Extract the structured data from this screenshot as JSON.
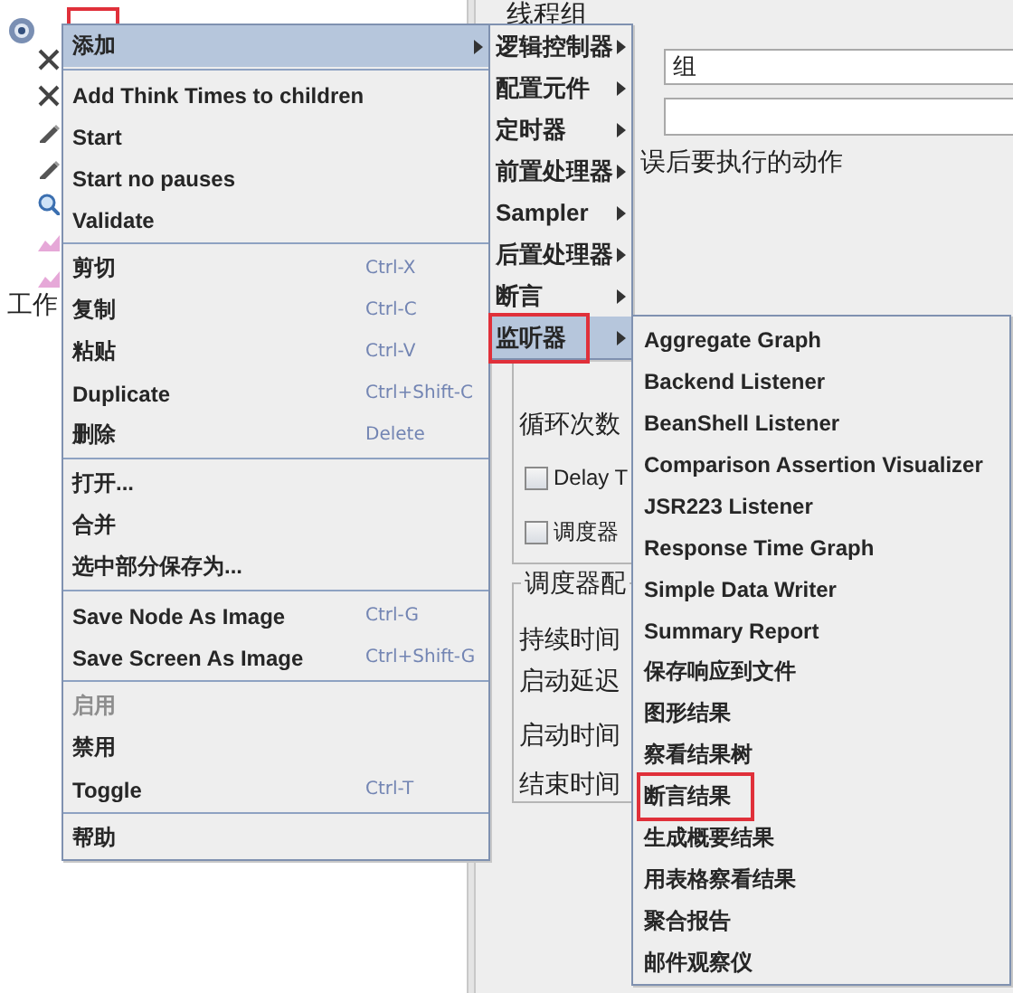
{
  "tree": {
    "root": {
      "annotated": true
    },
    "workbench": "工作"
  },
  "panel": {
    "title": "线程组",
    "name_value": "组",
    "error_action_label": "误后要执行的动作",
    "loop_label": "循环次数",
    "checkboxes": [
      {
        "label": "Delay T",
        "checked": false
      },
      {
        "label": "调度器",
        "checked": false
      }
    ],
    "scheduler_title": "调度器配",
    "scheduler_fields": [
      "持续时间",
      "启动延迟",
      "启动时间",
      "结束时间"
    ]
  },
  "context_menu": {
    "items": [
      {
        "kind": "item",
        "label": "添加",
        "submenu": true,
        "highlighted": true,
        "disabled": false,
        "annotated": false
      },
      {
        "kind": "separator"
      },
      {
        "kind": "item",
        "label": "Add Think Times to children",
        "submenu": false,
        "highlighted": false,
        "disabled": false,
        "annotated": false
      },
      {
        "kind": "item",
        "label": "Start",
        "submenu": false,
        "highlighted": false,
        "disabled": false,
        "annotated": false
      },
      {
        "kind": "item",
        "label": "Start no pauses",
        "submenu": false,
        "highlighted": false,
        "disabled": false,
        "annotated": false
      },
      {
        "kind": "item",
        "label": "Validate",
        "submenu": false,
        "highlighted": false,
        "disabled": false,
        "annotated": false
      },
      {
        "kind": "separator"
      },
      {
        "kind": "item",
        "label": "剪切",
        "shortcut": "Ctrl-X",
        "submenu": false,
        "highlighted": false,
        "disabled": false,
        "annotated": false
      },
      {
        "kind": "item",
        "label": "复制",
        "shortcut": "Ctrl-C",
        "submenu": false,
        "highlighted": false,
        "disabled": false,
        "annotated": false
      },
      {
        "kind": "item",
        "label": "粘贴",
        "shortcut": "Ctrl-V",
        "submenu": false,
        "highlighted": false,
        "disabled": false,
        "annotated": false
      },
      {
        "kind": "item",
        "label": "Duplicate",
        "shortcut": "Ctrl+Shift-C",
        "submenu": false,
        "highlighted": false,
        "disabled": false,
        "annotated": false
      },
      {
        "kind": "item",
        "label": "删除",
        "shortcut": "Delete",
        "submenu": false,
        "highlighted": false,
        "disabled": false,
        "annotated": false
      },
      {
        "kind": "separator"
      },
      {
        "kind": "item",
        "label": "打开...",
        "submenu": false,
        "highlighted": false,
        "disabled": false,
        "annotated": false
      },
      {
        "kind": "item",
        "label": "合并",
        "submenu": false,
        "highlighted": false,
        "disabled": false,
        "annotated": false
      },
      {
        "kind": "item",
        "label": "选中部分保存为...",
        "submenu": false,
        "highlighted": false,
        "disabled": false,
        "annotated": false
      },
      {
        "kind": "separator"
      },
      {
        "kind": "item",
        "label": "Save Node As Image",
        "shortcut": "Ctrl-G",
        "submenu": false,
        "highlighted": false,
        "disabled": false,
        "annotated": false
      },
      {
        "kind": "item",
        "label": "Save Screen As Image",
        "shortcut": "Ctrl+Shift-G",
        "submenu": false,
        "highlighted": false,
        "disabled": false,
        "annotated": false
      },
      {
        "kind": "separator"
      },
      {
        "kind": "item",
        "label": "启用",
        "submenu": false,
        "highlighted": false,
        "disabled": true,
        "annotated": false
      },
      {
        "kind": "item",
        "label": "禁用",
        "submenu": false,
        "highlighted": false,
        "disabled": false,
        "annotated": false
      },
      {
        "kind": "item",
        "label": "Toggle",
        "shortcut": "Ctrl-T",
        "submenu": false,
        "highlighted": false,
        "disabled": false,
        "annotated": false
      },
      {
        "kind": "separator"
      },
      {
        "kind": "item",
        "label": "帮助",
        "submenu": false,
        "highlighted": false,
        "disabled": false,
        "annotated": false
      }
    ]
  },
  "add_submenu": {
    "items": [
      {
        "kind": "item",
        "label": "逻辑控制器",
        "submenu": true,
        "highlighted": false,
        "annotated": false
      },
      {
        "kind": "item",
        "label": "配置元件",
        "submenu": true,
        "highlighted": false,
        "annotated": false
      },
      {
        "kind": "item",
        "label": "定时器",
        "submenu": true,
        "highlighted": false,
        "annotated": false
      },
      {
        "kind": "item",
        "label": "前置处理器",
        "submenu": true,
        "highlighted": false,
        "annotated": false
      },
      {
        "kind": "item",
        "label": "Sampler",
        "submenu": true,
        "highlighted": false,
        "annotated": false
      },
      {
        "kind": "item",
        "label": "后置处理器",
        "submenu": true,
        "highlighted": false,
        "annotated": false
      },
      {
        "kind": "item",
        "label": "断言",
        "submenu": true,
        "highlighted": false,
        "annotated": false
      },
      {
        "kind": "item",
        "label": "监听器",
        "submenu": true,
        "highlighted": true,
        "annotated": true
      }
    ]
  },
  "listener_submenu": {
    "items": [
      {
        "kind": "item",
        "label": "Aggregate Graph",
        "highlighted": false,
        "annotated": false
      },
      {
        "kind": "item",
        "label": "Backend Listener",
        "highlighted": false,
        "annotated": false
      },
      {
        "kind": "item",
        "label": "BeanShell Listener",
        "highlighted": false,
        "annotated": false
      },
      {
        "kind": "item",
        "label": "Comparison Assertion Visualizer",
        "highlighted": false,
        "annotated": false
      },
      {
        "kind": "item",
        "label": "JSR223 Listener",
        "highlighted": false,
        "annotated": false
      },
      {
        "kind": "item",
        "label": "Response Time Graph",
        "highlighted": false,
        "annotated": false
      },
      {
        "kind": "item",
        "label": "Simple Data Writer",
        "highlighted": false,
        "annotated": false
      },
      {
        "kind": "item",
        "label": "Summary Report",
        "highlighted": false,
        "annotated": false
      },
      {
        "kind": "item",
        "label": "保存响应到文件",
        "highlighted": false,
        "annotated": false
      },
      {
        "kind": "item",
        "label": "图形结果",
        "highlighted": false,
        "annotated": false
      },
      {
        "kind": "item",
        "label": "察看结果树",
        "highlighted": false,
        "annotated": false
      },
      {
        "kind": "item",
        "label": "断言结果",
        "highlighted": false,
        "annotated": true
      },
      {
        "kind": "item",
        "label": "生成概要结果",
        "highlighted": false,
        "annotated": false
      },
      {
        "kind": "item",
        "label": "用表格察看结果",
        "highlighted": false,
        "annotated": false
      },
      {
        "kind": "item",
        "label": "聚合报告",
        "highlighted": false,
        "annotated": false
      },
      {
        "kind": "item",
        "label": "邮件观察仪",
        "highlighted": false,
        "annotated": false
      }
    ]
  }
}
